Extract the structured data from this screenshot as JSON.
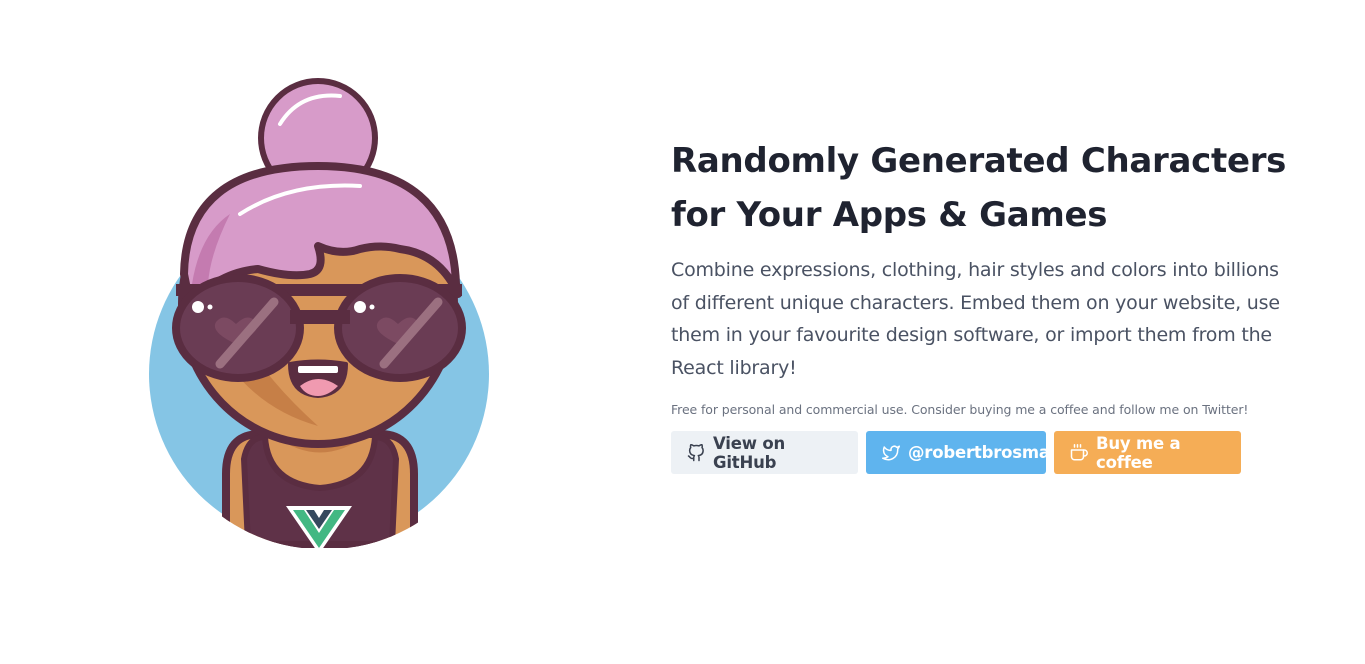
{
  "hero": {
    "title": "Randomly Generated Characters for Your Apps & Games",
    "description": "Combine expressions, clothing, hair styles and colors into billions of different unique characters. Embed them on your website, use them in your favourite design software, or import them from the React library!",
    "note": "Free for personal and commercial use. Consider buying me a coffee and follow me on Twitter!"
  },
  "buttons": {
    "github": {
      "label": "View on GitHub",
      "icon": "github-icon"
    },
    "twitter": {
      "label": "@robertbrosma",
      "icon": "twitter-icon"
    },
    "coffee": {
      "label": "Buy me a coffee",
      "icon": "coffee-cup-icon"
    }
  },
  "colors": {
    "background": "#ffffff",
    "circle": "#85c5e5",
    "hair": "#d79bc9",
    "outline": "#5a2d41",
    "skin": "#d9975a",
    "github_button": "#edf1f5",
    "twitter_button": "#5fb4ee",
    "coffee_button": "#f5ad56"
  }
}
